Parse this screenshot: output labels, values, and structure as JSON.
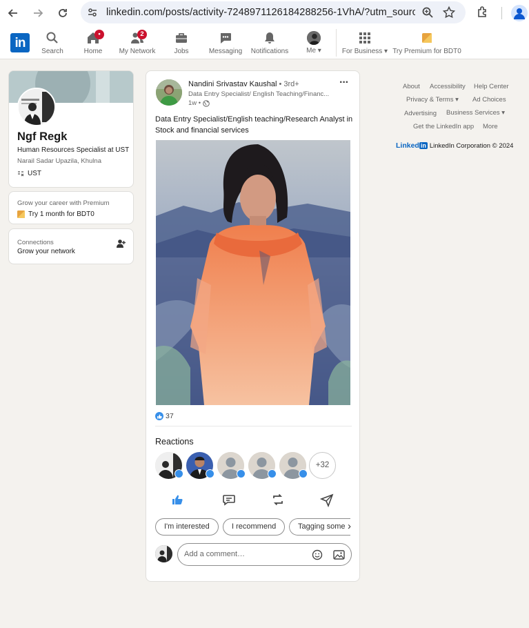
{
  "browser": {
    "url": "linkedin.com/posts/activity-7248971126184288256-1VhA/?utm_sourc..."
  },
  "nav": {
    "logo": "in",
    "items": [
      {
        "label": "Search"
      },
      {
        "label": "Home",
        "badge": "•"
      },
      {
        "label": "My Network",
        "badge": "2"
      },
      {
        "label": "Jobs"
      },
      {
        "label": "Messaging"
      },
      {
        "label": "Notifications"
      },
      {
        "label": "Me ▾"
      },
      {
        "label": "For Business ▾"
      },
      {
        "label": "Try Premium for BDT0"
      }
    ]
  },
  "profile": {
    "name": "Ngf Regk",
    "headline": "Human Resources Specialist at UST",
    "location": "Narail Sadar Upazila, Khulna",
    "company": "UST"
  },
  "premium": {
    "prompt": "Grow your career with Premium",
    "cta": "Try 1 month for BDT0"
  },
  "connections": {
    "title": "Connections",
    "subtitle": "Grow your network"
  },
  "post": {
    "author": "Nandini Srivastav Kaushal",
    "degree": "• 3rd+",
    "headline": "Data Entry Specialist/ English Teaching/Financ...",
    "time": "1w •",
    "text": "Data Entry Specialist/English teaching/Research Analyst in Stock and financial services",
    "likes": "37",
    "reactions_title": "Reactions",
    "more_reactions": "+32",
    "chips": [
      "I'm interested",
      "I recommend",
      "Tagging some"
    ],
    "comment_placeholder": "Add a comment…"
  },
  "footer": {
    "links": [
      "About",
      "Accessibility",
      "Help Center",
      "Privacy & Terms ▾",
      "Ad Choices",
      "Advertising",
      "Business Services ▾",
      "Get the LinkedIn app",
      "More"
    ],
    "brand": "Linked",
    "brand_in": "in",
    "copyright": "LinkedIn Corporation © 2024"
  },
  "colors": {
    "linkedin_blue": "#0a66c2",
    "badge_red": "#cb112d",
    "page_bg": "#f4f2ee"
  }
}
